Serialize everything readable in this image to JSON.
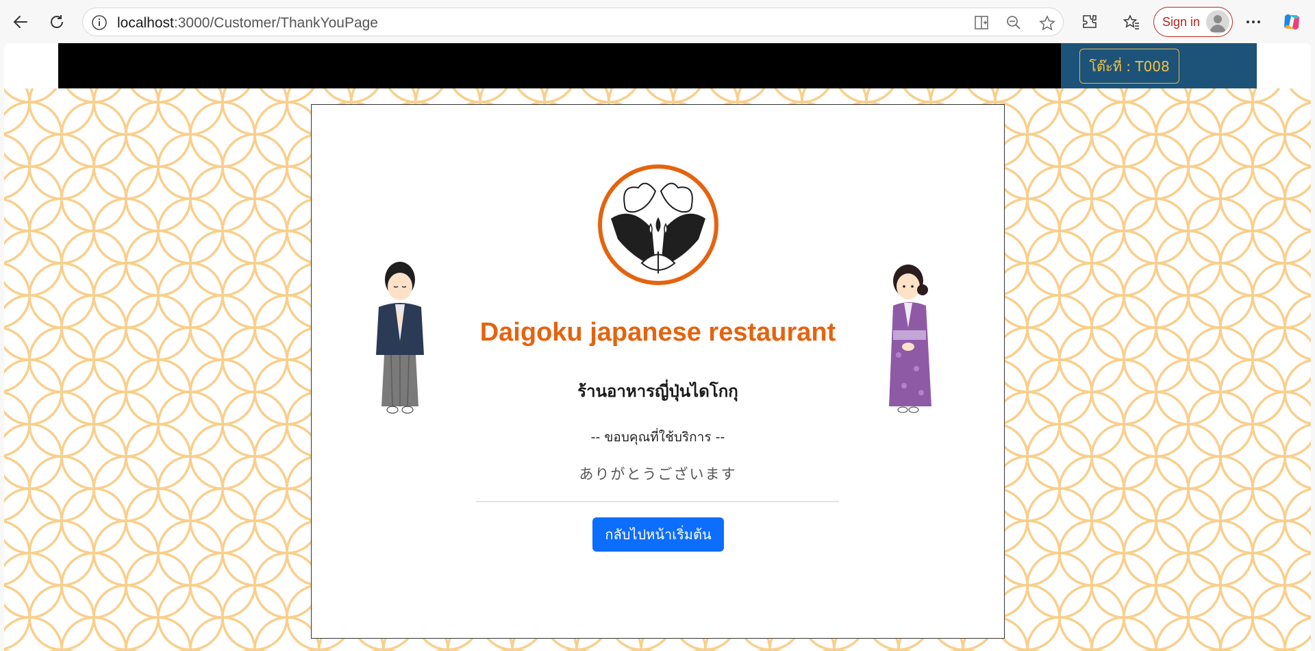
{
  "browser": {
    "url_host": "localhost",
    "url_path": ":3000/Customer/ThankYouPage",
    "signin_label": "Sign in"
  },
  "page": {
    "table_label": "โต๊ะที่ : T008",
    "title": "Daigoku japanese restaurant",
    "subtitle": "ร้านอาหารญี่ปุ่นไดโกกุ",
    "thanks_th": "-- ขอบคุณที่ใช้บริการ --",
    "thanks_jp": "ありがとうございます",
    "home_button": "กลับไปหน้าเริ่มต้น"
  },
  "colors": {
    "title": "#e5630f",
    "button": "#0d6efd",
    "pattern": "#f9cf8b",
    "topbar": "#000000",
    "table_zone": "#1d5378",
    "badge": "#f5c242"
  },
  "icons": [
    "back-arrow-icon",
    "refresh-icon",
    "info-icon",
    "split-screen-icon",
    "zoom-out-icon",
    "favorite-star-icon",
    "extensions-icon",
    "favorites-icon",
    "profile-avatar-icon",
    "more-icon",
    "copilot-icon"
  ]
}
